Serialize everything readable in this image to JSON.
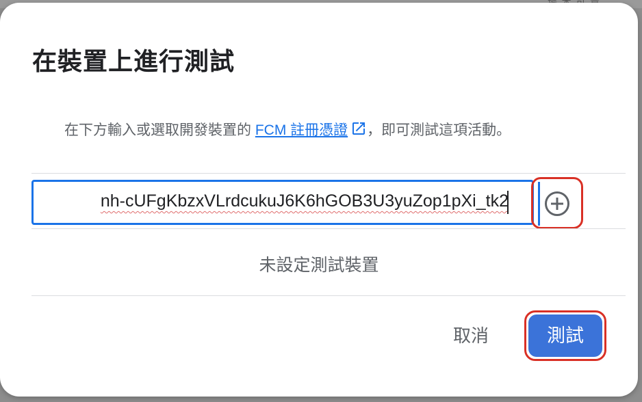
{
  "backdrop": {
    "text": "振·本·可·貢"
  },
  "dialog": {
    "title": "在裝置上進行測試",
    "description_prefix": "在下方輸入或選取開發裝置的 ",
    "description_link": "FCM 註冊憑證",
    "description_suffix": "，即可測試這項活動。",
    "token_input_value": "nh-cUFgKbzxVLrdcukuJ6K6hGOB3U3yuZop1pXi_tk2",
    "add_icon": "add-circle-icon",
    "link_icon": "open-in-new-icon",
    "empty_message": "未設定測試裝置",
    "cancel_label": "取消",
    "test_label": "測試"
  },
  "colors": {
    "accent": "#1a73e8",
    "primary_button": "#3b73d9",
    "highlight": "#d93025"
  }
}
